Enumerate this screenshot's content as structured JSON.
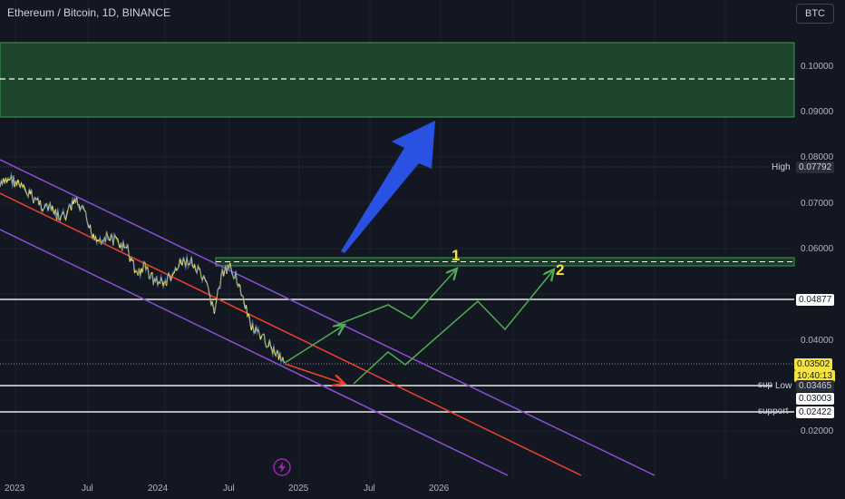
{
  "header": {
    "title": "Ethereum / Bitcoin, 1D, BINANCE",
    "currency_button": "BTC"
  },
  "price_labels": {
    "high_text": "High",
    "high_value": "0.07792",
    "level_1": "0.04877",
    "current_value": "0.03502",
    "countdown": "10:40:13",
    "low_text": "Low",
    "low_value": "0.03465",
    "level_2": "0.03003",
    "level_3": "0.02422"
  },
  "line_labels": {
    "sup": "sup",
    "support": "support"
  },
  "markers": {
    "one": "1",
    "two": "2"
  },
  "chart_data": {
    "type": "line",
    "title": "Ethereum / Bitcoin, 1D, BINANCE",
    "y_ticks": [
      "0.10000",
      "0.09000",
      "0.08000",
      "0.07000",
      "0.06000",
      "0.04000",
      "0.02000"
    ],
    "x_ticks": [
      "2023",
      "Jul",
      "2024",
      "Jul",
      "2025",
      "Jul",
      "2026"
    ],
    "ylim": [
      0.018,
      0.115
    ],
    "series": [
      {
        "x": [
          "2022-11-01",
          "2022-11-25",
          "2022-12-15",
          "2023-01-05",
          "2023-01-25",
          "2023-02-20",
          "2023-03-15",
          "2023-04-10",
          "2023-04-25",
          "2023-05-15",
          "2023-06-10",
          "2023-06-25",
          "2023-07-15",
          "2023-08-10",
          "2023-09-05",
          "2023-10-01",
          "2023-10-25",
          "2023-11-15",
          "2023-12-10",
          "2024-01-05",
          "2024-01-25",
          "2024-02-15",
          "2024-03-10",
          "2024-04-05",
          "2024-04-25",
          "2024-05-15",
          "2024-06-05",
          "2024-06-25",
          "2024-07-10",
          "2024-08-01",
          "2024-08-20",
          "2024-09-10",
          "2024-10-01",
          "2024-10-20",
          "2024-11-05",
          "2024-11-15"
        ],
        "values": [
          0.0735,
          0.0755,
          0.0745,
          0.0725,
          0.0715,
          0.0695,
          0.0685,
          0.0665,
          0.0675,
          0.0705,
          0.0675,
          0.064,
          0.062,
          0.0625,
          0.0615,
          0.0595,
          0.0545,
          0.056,
          0.053,
          0.0525,
          0.054,
          0.0565,
          0.0575,
          0.0545,
          0.0515,
          0.0465,
          0.0545,
          0.0555,
          0.0545,
          0.0475,
          0.043,
          0.0405,
          0.0395,
          0.0375,
          0.0365,
          0.035
        ]
      }
    ],
    "horizontal_levels": [
      0.04877,
      0.03465,
      0.03003,
      0.02422,
      0.07792
    ],
    "zones": [
      {
        "from": 0.089,
        "to": 0.1045,
        "mid": 0.0972
      },
      {
        "from": 0.0567,
        "to": 0.0583,
        "mid": 0.0575
      }
    ],
    "grid": true,
    "legend": "none"
  },
  "colors": {
    "background": "#131722",
    "price_line": "#f5e342",
    "channel": "#8b4fd8",
    "midline": "#f0412b",
    "projection": "#4caf50",
    "arrow": "#2952e3",
    "zone": "#1f4d2e"
  },
  "icons": {
    "flash": "lightning-icon"
  }
}
